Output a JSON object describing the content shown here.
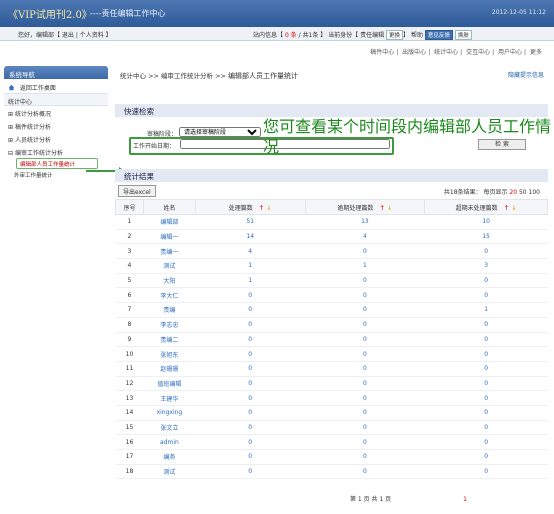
{
  "header": {
    "logo": "《VIP试用刊2.0》",
    "system": "----责任编辑工作中心",
    "date": "2012-12-05 11:12"
  },
  "userbar": {
    "greeting": "您好，编辑部【 退出 | 个人资料 】",
    "status_prefix": "站内信息【",
    "unread": "0 条",
    "status_total": "/ 共1条 】",
    "role_prefix": "当前身份【 责任编辑",
    "switch": "更换",
    "help": "帮助",
    "feedback": "意见反馈",
    "logout": "换肤"
  },
  "topnav": [
    "稿件中心",
    "出版中心",
    "统计中心",
    "交互中心",
    "用户中心",
    "更多"
  ],
  "sidebar": {
    "title": "系统导航",
    "back": "返回工作桌面",
    "section": "统计中心",
    "items": [
      "统计分析概况",
      "稿件统计分析",
      "人员统计分析",
      "编审工作统计分析"
    ],
    "subitems": [
      "编辑部人员工作量统计",
      "外审工作量统计"
    ]
  },
  "breadcrumb": {
    "path": "统计中心 >> 编审工作统计分析 >> ",
    "current": "编辑部人员工作量统计"
  },
  "tip": "隐藏提示信息",
  "search": {
    "title": "快速检索",
    "stage_label": "审稿阶段：",
    "stage_value": "请选择审稿阶段",
    "date_label": "工作开始日期：",
    "button": "检 索"
  },
  "overlay": "您可查看某个时间段内编辑部人员工作情况",
  "results": {
    "title": "统计结果",
    "export": "导出excel",
    "total": "共18条结果：",
    "per_page": "每页显示",
    "sizes": [
      "20",
      "50",
      "100"
    ]
  },
  "table": {
    "headers": [
      "序号",
      "姓名",
      "处理篇数",
      "逾期处理篇数",
      "超期未处理篇数"
    ],
    "rows": [
      [
        "1",
        "编辑部",
        "51",
        "13",
        "10"
      ],
      [
        "2",
        "编辑一",
        "14",
        "4",
        "15"
      ],
      [
        "3",
        "责编一",
        "4",
        "0",
        "0"
      ],
      [
        "4",
        "测试",
        "1",
        "1",
        "3"
      ],
      [
        "5",
        "大阳",
        "1",
        "0",
        "0"
      ],
      [
        "6",
        "李大仁",
        "0",
        "0",
        "0"
      ],
      [
        "7",
        "责编",
        "0",
        "0",
        "1"
      ],
      [
        "8",
        "李志忠",
        "0",
        "0",
        "0"
      ],
      [
        "9",
        "责编二",
        "0",
        "0",
        "0"
      ],
      [
        "10",
        "张旭东",
        "0",
        "0",
        "0"
      ],
      [
        "11",
        "赵珊珊",
        "0",
        "0",
        "0"
      ],
      [
        "12",
        "值班编辑",
        "0",
        "0",
        "0"
      ],
      [
        "13",
        "王建华",
        "0",
        "0",
        "0"
      ],
      [
        "14",
        "xingxing",
        "0",
        "0",
        "0"
      ],
      [
        "15",
        "张文立",
        "0",
        "0",
        "0"
      ],
      [
        "16",
        "admin",
        "0",
        "0",
        "0"
      ],
      [
        "17",
        "编务",
        "0",
        "0",
        "0"
      ],
      [
        "18",
        "测试",
        "0",
        "0",
        "0"
      ]
    ]
  },
  "pager": {
    "text": "第 1 页 共 1 页",
    "current": "1"
  }
}
